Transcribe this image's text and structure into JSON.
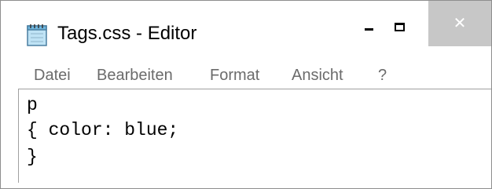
{
  "window": {
    "title": "Tags.css - Editor",
    "app_icon": "notepad-icon",
    "controls": {
      "minimize_icon": "minimize-icon",
      "maximize_icon": "maximize-icon",
      "close_icon": "close-icon",
      "close_glyph": "✕"
    }
  },
  "menu": {
    "items": [
      {
        "label": "Datei"
      },
      {
        "label": "Bearbeiten"
      },
      {
        "label": "Format"
      },
      {
        "label": "Ansicht"
      },
      {
        "label": "?"
      }
    ]
  },
  "editor": {
    "lines": [
      "p",
      "{ color: blue;",
      "}"
    ]
  },
  "colors": {
    "menu_text": "#6b6b6b",
    "close_button_bg": "#c7c7c7",
    "window_border": "#8e8e8e"
  }
}
